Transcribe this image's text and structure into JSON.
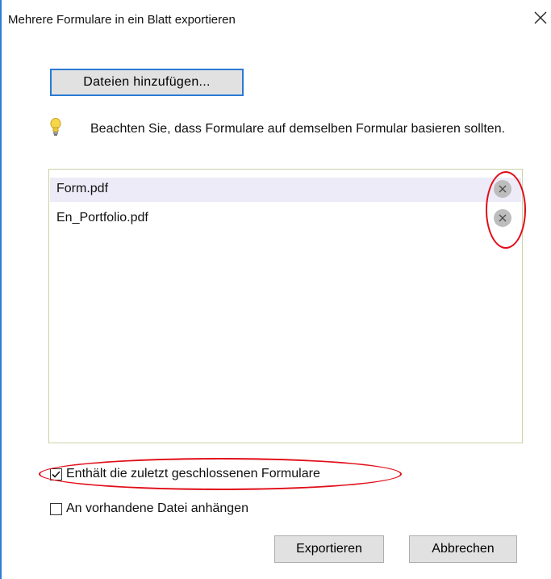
{
  "dialog": {
    "title": "Mehrere Formulare in ein Blatt exportieren",
    "add_files_label": "Dateien hinzufügen...",
    "hint": "Beachten Sie, dass Formulare auf demselben Formular basieren sollten.",
    "files": [
      {
        "name": "Form.pdf",
        "selected": true
      },
      {
        "name": "En_Portfolio.pdf",
        "selected": false
      }
    ],
    "options": {
      "include_recently_closed": {
        "label": "Enthält die zuletzt geschlossenen Formulare",
        "checked": true
      },
      "append_existing": {
        "label": "An vorhandene Datei anhängen",
        "checked": false
      }
    },
    "buttons": {
      "export": "Exportieren",
      "cancel": "Abbrechen"
    }
  },
  "colors": {
    "accent": "#2a7ad4",
    "annotation": "#e10c17",
    "selection": "#ecebf7"
  }
}
